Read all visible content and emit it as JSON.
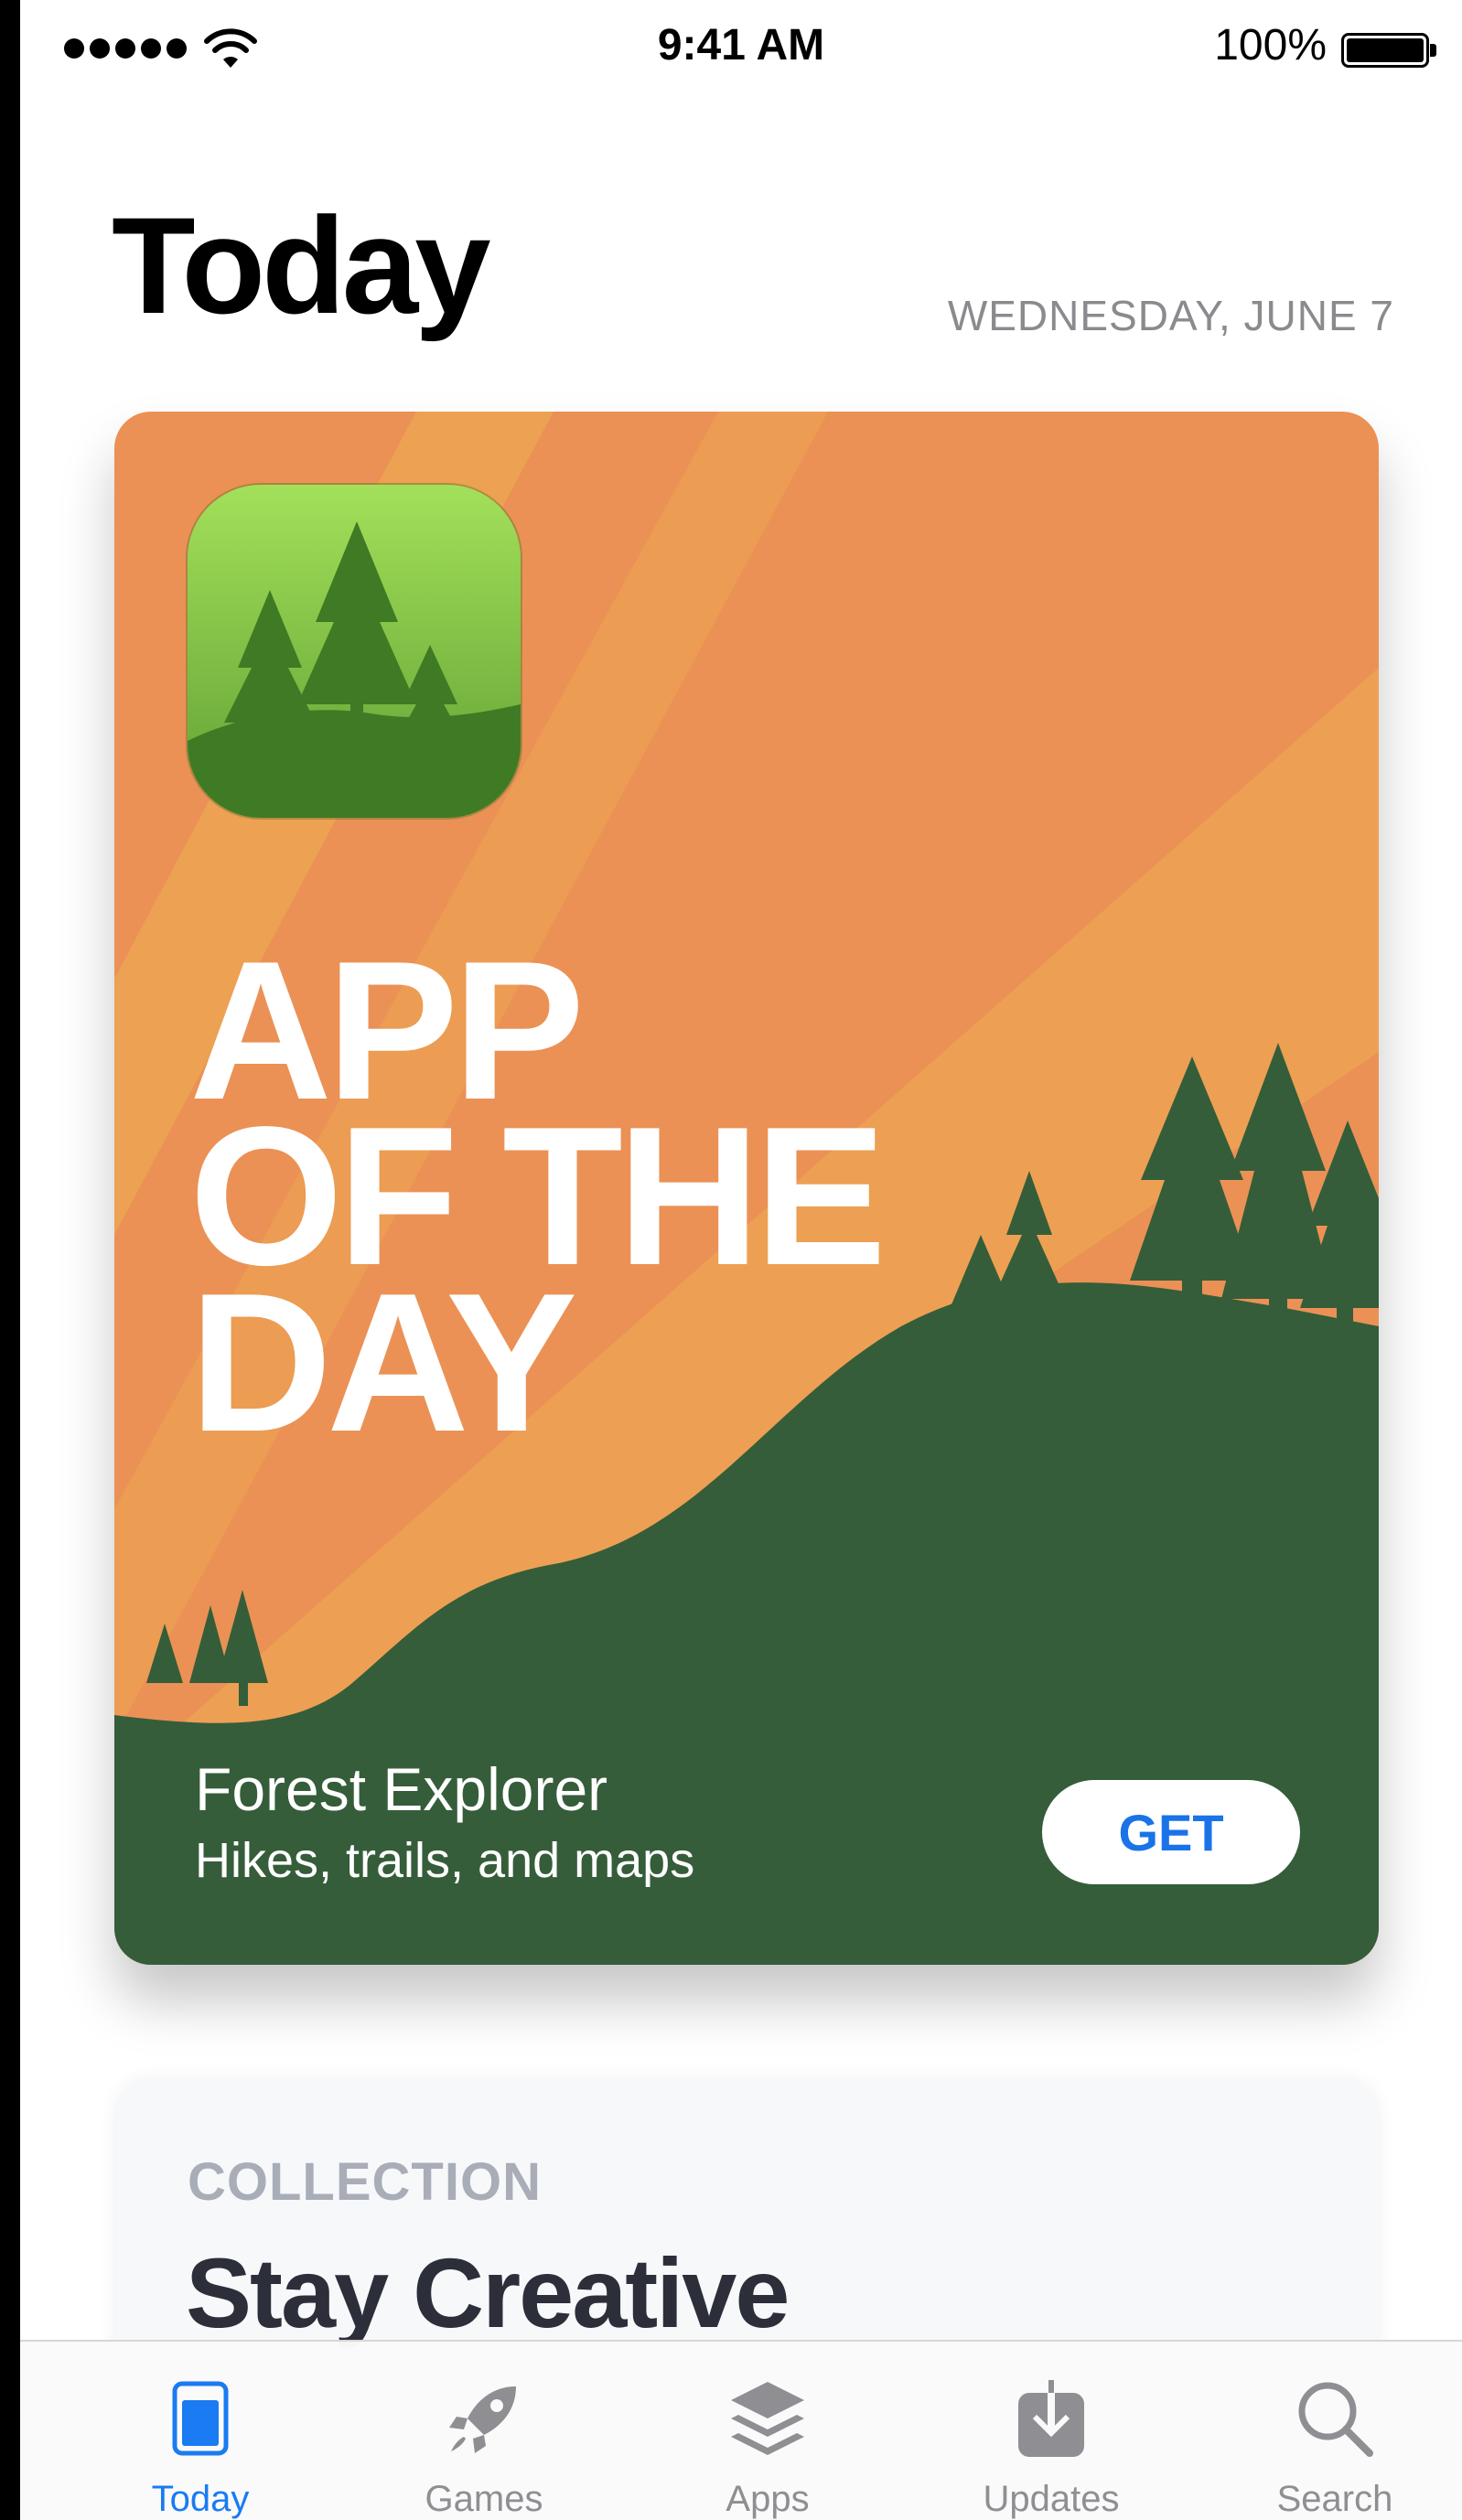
{
  "status_bar": {
    "time": "9:41 AM",
    "battery_percent": "100%",
    "battery_level": 1.0,
    "signal_bars": 5
  },
  "header": {
    "title": "Today",
    "date": "WEDNESDAY, JUNE 7"
  },
  "featured_card": {
    "headline_lines": [
      "APP",
      "OF THE",
      "DAY"
    ],
    "app_name": "Forest Explorer",
    "app_subtitle": "Hikes, trails, and maps",
    "button_label": "GET",
    "colors": {
      "background": "#eb9155",
      "hill": "#355d3a",
      "button_text": "#1a73e8"
    }
  },
  "collection_card": {
    "kicker": "COLLECTION",
    "title": "Stay Creative"
  },
  "tab_bar": {
    "active": "Today",
    "tabs": [
      {
        "label": "Today",
        "icon": "today-icon"
      },
      {
        "label": "Games",
        "icon": "rocket-icon"
      },
      {
        "label": "Apps",
        "icon": "layers-icon"
      },
      {
        "label": "Updates",
        "icon": "download-icon"
      },
      {
        "label": "Search",
        "icon": "search-icon"
      }
    ],
    "colors": {
      "active": "#1a7bf2",
      "inactive": "#8e8e93"
    }
  }
}
